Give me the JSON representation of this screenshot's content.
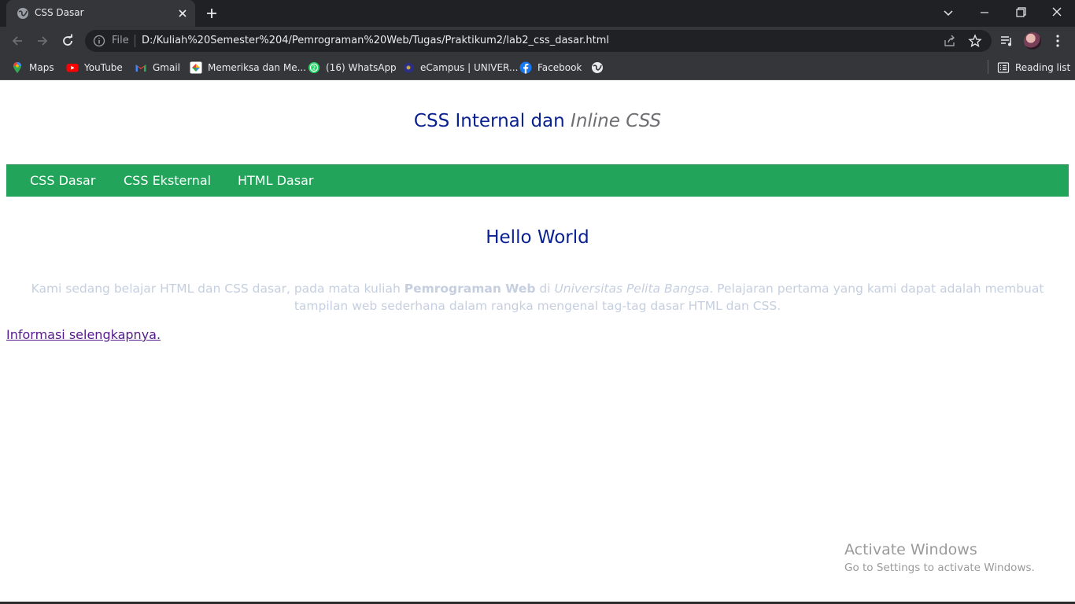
{
  "browser": {
    "tab_title": "CSS Dasar",
    "url_scheme": "File",
    "url": "D:/Kuliah%20Semester%204/Pemrograman%20Web/Tugas/Praktikum2/lab2_css_dasar.html",
    "bookmarks": [
      {
        "label": "Maps",
        "icon": "maps-icon"
      },
      {
        "label": "YouTube",
        "icon": "youtube-icon"
      },
      {
        "label": "Gmail",
        "icon": "gmail-icon"
      },
      {
        "label": "Memeriksa dan Me...",
        "icon": "review-icon"
      },
      {
        "label": "(16) WhatsApp",
        "icon": "whatsapp-icon"
      },
      {
        "label": "eCampus | UNIVER...",
        "icon": "ecampus-icon"
      },
      {
        "label": "Facebook",
        "icon": "facebook-icon"
      },
      {
        "label": "",
        "icon": "globe-icon"
      }
    ],
    "reading_list": "Reading list"
  },
  "page": {
    "title_plain": "CSS Internal dan ",
    "title_italic": "Inline CSS",
    "nav": [
      "CSS Dasar",
      "CSS Eksternal",
      "HTML Dasar"
    ],
    "heading": "Hello World",
    "paragraph": {
      "t1": "Kami sedang belajar HTML dan CSS dasar, pada mata kuliah ",
      "bold": "Pemrograman Web",
      "t2": " di ",
      "italic": "Universitas Pelita Bangsa",
      "t3": ". Pelajaran pertama yang kami dapat adalah membuat tampilan web sederhana dalam rangka mengenal tag-tag dasar HTML dan CSS."
    },
    "more_link": "Informasi selengkapnya."
  },
  "watermark": {
    "line1": "Activate Windows",
    "line2": "Go to Settings to activate Windows."
  },
  "colors": {
    "nav_bg": "#22a45a",
    "heading": "#0a2192",
    "paragraph": "#c5cfe0",
    "link_visited": "#551a8b"
  }
}
